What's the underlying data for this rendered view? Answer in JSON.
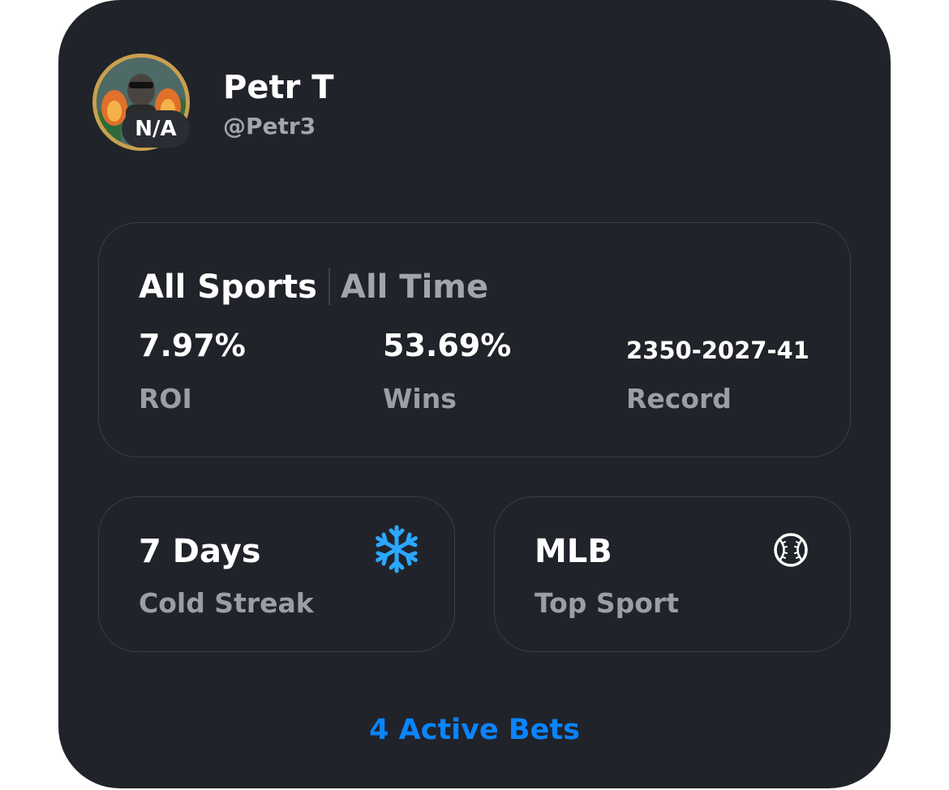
{
  "profile": {
    "name": "Petr T",
    "handle": "@Petr3",
    "rank_badge": "N/A",
    "avatar_ring_color": "#c9a04e"
  },
  "stats": {
    "sport_filter": "All Sports",
    "time_filter": "All Time",
    "roi": {
      "value": "7.97%",
      "label": "ROI"
    },
    "wins": {
      "value": "53.69%",
      "label": "Wins"
    },
    "record": {
      "value": "2350-2027-41",
      "label": "Record"
    }
  },
  "streak": {
    "value": "7 Days",
    "label": "Cold Streak",
    "icon": "snowflake-icon",
    "icon_color": "#2aa8ff"
  },
  "top_sport": {
    "value": "MLB",
    "label": "Top Sport",
    "icon": "baseball-icon"
  },
  "footer": {
    "active_bets": "4 Active Bets",
    "accent_color": "#0a84ff"
  },
  "colors": {
    "card_background": "#21232a",
    "panel_border": "#3a3d45",
    "primary_text": "#ffffff",
    "secondary_text": "#9c9ea4"
  }
}
